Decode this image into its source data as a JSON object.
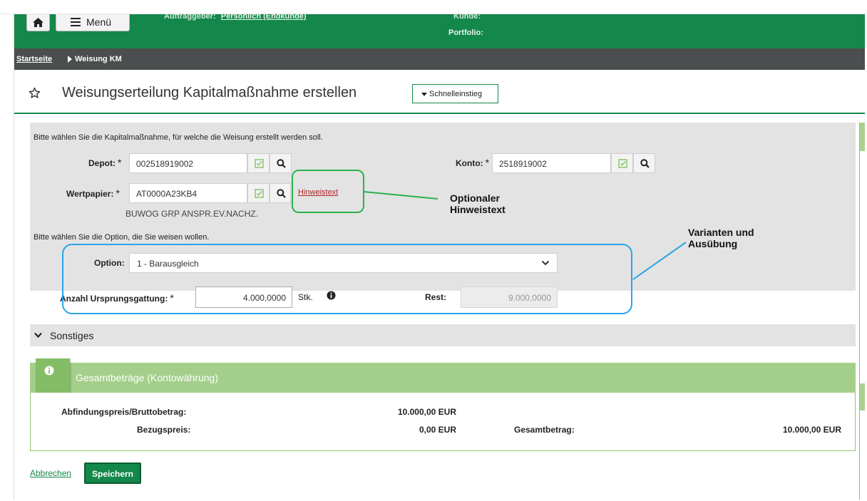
{
  "header": {
    "menu_label": "Menü",
    "auftraggeber_label": "Auftraggeber:",
    "auftraggeber_value": "Persönlich (Endkunde)",
    "kunde_label": "Kunde:",
    "portfolio_label": "Portfolio:"
  },
  "breadcrumb": {
    "home": "Startseite",
    "current": "Weisung KM"
  },
  "page": {
    "title": "Weisungserteilung Kapitalmaßnahme erstellen",
    "quick_entry": "Schnelleinstieg"
  },
  "form": {
    "intro_select": "Bitte wählen Sie die Kapitalmaßnahme, für welche die Weisung erstellt werden soll.",
    "depot_label": "Depot:",
    "depot_value": "002518919002",
    "konto_label": "Konto:",
    "konto_value": "2518919002",
    "wertpapier_label": "Wertpapier:",
    "wertpapier_value": "AT0000A23KB4",
    "wertpapier_name": "BUWOG GRP ANSPR.EV.NACHZ.",
    "hint_link": "Hinweistext",
    "intro_option": "Bitte wählen Sie die Option, die Sie weisen wollen.",
    "option_label": "Option:",
    "option_value": "1 - Barausgleich",
    "anzahl_label": "Anzahl Ursprungsgattung:",
    "anzahl_value": "4.000,0000",
    "unit": "Stk.",
    "rest_label": "Rest:",
    "rest_value": "9.000,0000",
    "required_mark": "*"
  },
  "sonstiges": {
    "label": "Sonstiges"
  },
  "gesamt": {
    "title": "Gesamtbeträge (Kontowährung)",
    "abfindung_label": "Abfindungspreis/Bruttobetrag:",
    "abfindung_value": "10.000,00 EUR",
    "bezugspreis_label": "Bezugspreis:",
    "bezugspreis_value": "0,00 EUR",
    "gesamtbetrag_label": "Gesamtbetrag:",
    "gesamtbetrag_value": "10.000,00 EUR"
  },
  "actions": {
    "cancel": "Abbrechen",
    "save": "Speichern"
  },
  "annotations": {
    "hint_line1": "Optionaler",
    "hint_line2": "Hinweistext",
    "variant_line1": "Varianten und",
    "variant_line2": "Ausübung"
  },
  "colors": {
    "brand_green": "#14874a",
    "panel_green": "#a3cf8a",
    "annotation_green": "#2bb24c",
    "annotation_blue": "#2aa5e6",
    "link_red": "#b0242a"
  }
}
